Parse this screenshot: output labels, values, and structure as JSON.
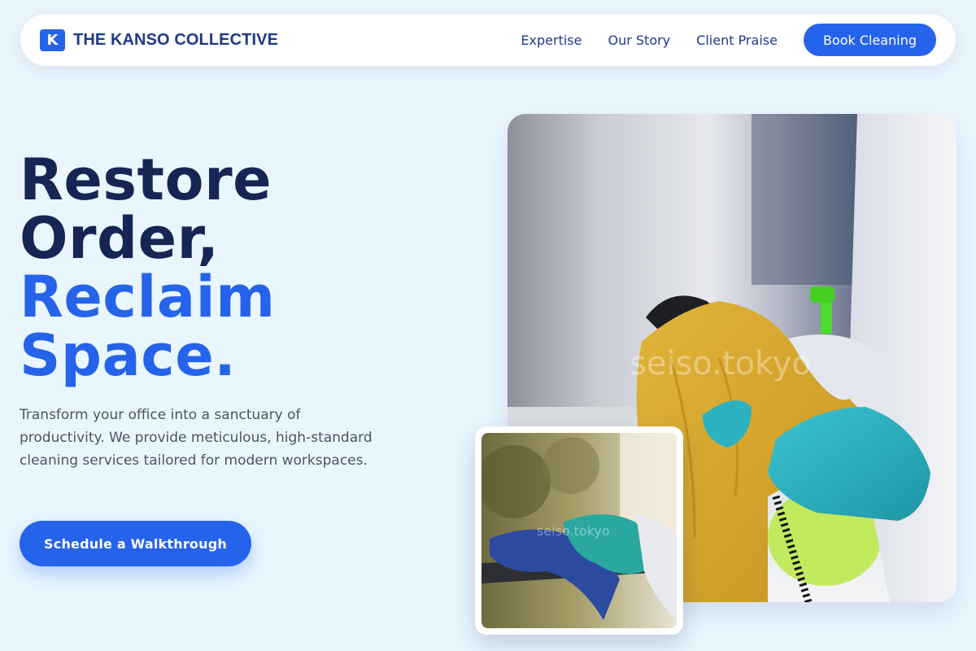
{
  "brand": {
    "logo_letter": "K",
    "name": "THE KANSO COLLECTIVE"
  },
  "nav": {
    "links": [
      "Expertise",
      "Our Story",
      "Client Praise"
    ],
    "cta_label": "Book Cleaning"
  },
  "hero": {
    "headline_line1": "Restore",
    "headline_line2": "Order,",
    "headline_line3": "Reclaim",
    "headline_line4": "Space.",
    "subtext": "Transform your office into a sanctuary of productivity. We provide meticulous, high-standard cleaning services tailored for modern workspaces.",
    "cta_label": "Schedule a Walkthrough"
  },
  "images": {
    "main_watermark": "seiso.tokyo",
    "thumb_watermark": "seiso.tokyo"
  },
  "colors": {
    "background": "#eaf6fe",
    "primary": "#2563eb",
    "navy": "#172554",
    "brand_text": "#1e3a8a",
    "body_text": "#4b5563"
  }
}
